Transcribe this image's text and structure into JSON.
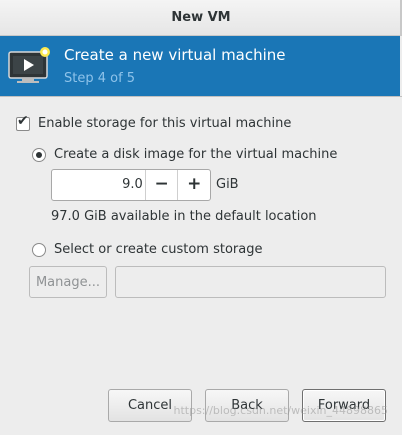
{
  "window": {
    "title": "New VM"
  },
  "header": {
    "icon": "monitor-play-icon",
    "title": "Create a new virtual machine",
    "step": "Step 4 of 5",
    "bg_color": "#1a76b6",
    "step_color": "#8ec3ea"
  },
  "storage": {
    "enable_label": "Enable storage for this virtual machine",
    "enable_checked": true,
    "disk_image_label": "Create a disk image for the virtual machine",
    "disk_image_selected": true,
    "size_value": "9.0",
    "decrement": "−",
    "increment": "+",
    "unit": "GiB",
    "available_text": "97.0 GiB available in the default location",
    "custom_label": "Select or create custom storage",
    "custom_selected": false,
    "manage_label": "Manage...",
    "custom_path": ""
  },
  "buttons": {
    "cancel": "Cancel",
    "back": "Back",
    "forward": "Forward"
  },
  "watermark": "https://blog.csdn.net/weixin_44898865"
}
